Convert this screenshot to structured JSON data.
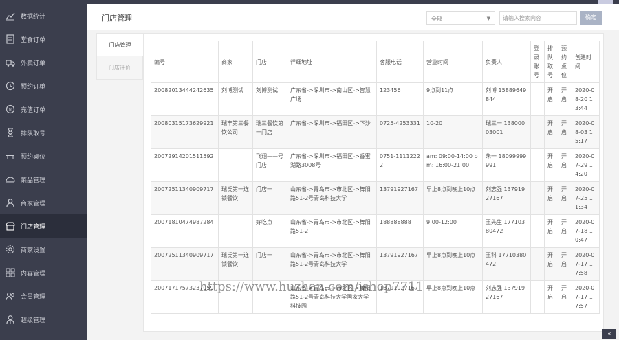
{
  "sidebar": {
    "items": [
      {
        "label": "数据统计",
        "icon": "chart-icon"
      },
      {
        "label": "堂食订单",
        "icon": "receipt-icon"
      },
      {
        "label": "外卖订单",
        "icon": "delivery-icon"
      },
      {
        "label": "预约订单",
        "icon": "clock-icon"
      },
      {
        "label": "充值订单",
        "icon": "recharge-icon"
      },
      {
        "label": "排队取号",
        "icon": "hourglass-icon"
      },
      {
        "label": "预约桌位",
        "icon": "table-icon"
      },
      {
        "label": "菜品管理",
        "icon": "dish-icon"
      },
      {
        "label": "商家管理",
        "icon": "user-icon"
      },
      {
        "label": "门店管理",
        "icon": "store-icon"
      },
      {
        "label": "商家设置",
        "icon": "gear-icon"
      },
      {
        "label": "内容管理",
        "icon": "grid-icon"
      },
      {
        "label": "会员管理",
        "icon": "members-icon"
      },
      {
        "label": "超级管理",
        "icon": "admin-icon"
      }
    ],
    "active_index": 9
  },
  "header": {
    "title": "门店管理",
    "filter_value": "全部",
    "search_placeholder": "请输入搜索内容",
    "confirm_label": "确定"
  },
  "tabs": [
    {
      "label": "门店管理",
      "active": true
    },
    {
      "label": "门店评价",
      "active": false
    }
  ],
  "table": {
    "headers": [
      "编号",
      "商家",
      "门店",
      "详细地址",
      "客服电话",
      "营业时间",
      "负责人",
      "登录账号",
      "排队取号",
      "预约桌位",
      "创建时间"
    ],
    "rows": [
      [
        "20082013444242635",
        "刘博测试",
        "刘博测试",
        "广东省->深圳市->南山区->智慧广场",
        "123456",
        "9点到11点",
        "刘博 15889649844",
        "",
        "开启",
        "开启",
        "2020-08-20 13:44"
      ],
      [
        "20080315173629921",
        "瑞丰第三餐饮公司",
        "瑞三餐饮第一门店",
        "广东省->深圳市->福田区->下沙",
        "0725-4253331",
        "10-20",
        "瑞三一 13800003001",
        "",
        "开启",
        "开启",
        "2020-08-03 15:17"
      ],
      [
        "20072914201511592",
        "",
        "飞翔——号门店",
        "广东省->深圳市->福田区->香蜜湖路3008号",
        "0751-11112222",
        "am: 09:00-14:00 pm: 16:00-21:00",
        "朱一 18099999991",
        "",
        "开启",
        "开启",
        "2020-07-29 14:20"
      ],
      [
        "20072511340909717",
        "瑞氏第一连锁餐饮",
        "门店一",
        "山东省->青岛市->市北区->舞阳路51-2号青岛科技大学",
        "13791927167",
        "早上8点到晚上10点",
        "刘志强 13791927167",
        "",
        "开启",
        "开启",
        "2020-07-25 11:34"
      ],
      [
        "20071810474987284",
        "",
        "好吃点",
        "山东省->青岛市->市北区->舞阳路51-2",
        "188888888",
        "9:00-12:00",
        "王先生 17710380472",
        "",
        "开启",
        "开启",
        "2020-07-18 10:47"
      ],
      [
        "20072511340909717",
        "瑞氏第一连锁餐饮",
        "门店一",
        "山东省->青岛市->市北区->舞阳路51-2号青岛科技大学",
        "13791927167",
        "早上8点到晚上10点",
        "王科 17710380472",
        "",
        "开启",
        "开启",
        "2020-07-17 17:58"
      ],
      [
        "20071717573237059",
        "",
        "",
        "山东省->青岛市->市北区->舞阳路51-2号青岛科技大学国家大学科技园",
        "13791927167",
        "早上8点到晚上10点",
        "刘志强 13791927167",
        "",
        "开启",
        "开启",
        "2020-07-17 17:57"
      ]
    ]
  },
  "watermark": "https://www.huzhan.com/ishop7711",
  "scroll_top_label": "«"
}
